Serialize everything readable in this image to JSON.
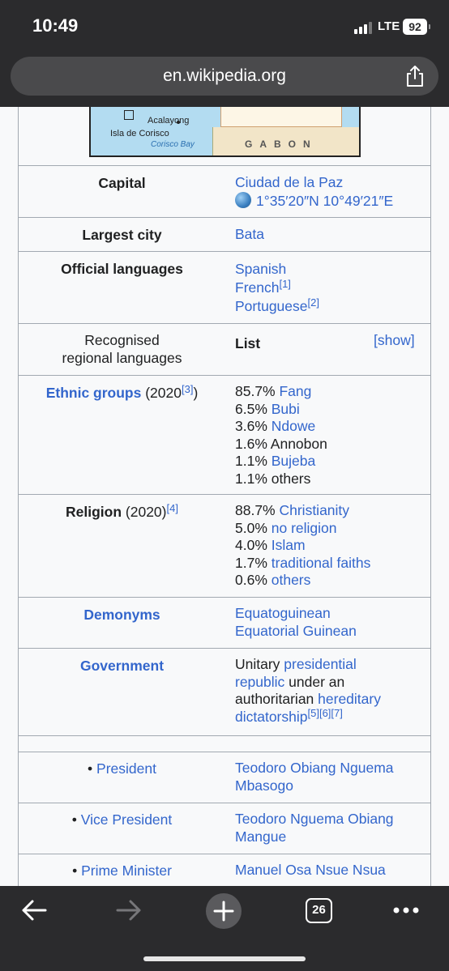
{
  "status_bar": {
    "time": "10:49",
    "network": "LTE",
    "battery": "92"
  },
  "browser": {
    "url": "en.wikipedia.org",
    "tab_count": "26"
  },
  "map": {
    "place1": "Acalayong",
    "place2": "Isla de Corisco",
    "bay": "Corisco Bay",
    "country": "GABON"
  },
  "infobox": {
    "capital": {
      "label": "Capital",
      "city": "Ciudad de la Paz",
      "coords": "1°35′20″N 10°49′21″E"
    },
    "largest_city": {
      "label": "Largest city",
      "value": "Bata"
    },
    "official_languages": {
      "label": "Official languages",
      "items": [
        "Spanish",
        "French",
        "Portuguese"
      ],
      "refs": [
        "[1]",
        "[2]"
      ]
    },
    "regional_languages": {
      "label_line1": "Recognised",
      "label_line2": "regional languages",
      "value": "List",
      "toggle": "[show]"
    },
    "ethnic_groups": {
      "label": "Ethnic groups",
      "year": " (2020",
      "ref": "[3]",
      "close": ")",
      "items": [
        {
          "pct": "85.7% ",
          "name": "Fang"
        },
        {
          "pct": "6.5% ",
          "name": "Bubi"
        },
        {
          "pct": "3.6% ",
          "name": "Ndowe"
        },
        {
          "pct": "1.6% ",
          "name": "Annobon"
        },
        {
          "pct": "1.1% ",
          "name": "Bujeba"
        },
        {
          "pct": "1.1% ",
          "name": "others"
        }
      ]
    },
    "religion": {
      "label": "Religion",
      "year": " (2020)",
      "ref": "[4]",
      "items": [
        {
          "pct": "88.7% ",
          "name": "Christianity"
        },
        {
          "pct": "5.0% ",
          "name": "no religion"
        },
        {
          "pct": "4.0% ",
          "name": "Islam"
        },
        {
          "pct": "1.7% ",
          "name": "traditional faiths"
        },
        {
          "pct": "0.6% ",
          "name": "others"
        }
      ]
    },
    "demonyms": {
      "label": "Demonyms",
      "items": [
        "Equatoguinean",
        "Equatorial Guinean"
      ]
    },
    "government": {
      "label": "Government",
      "t1": "Unitary ",
      "l1": "presidential",
      "l2": "republic",
      "t2": " under an",
      "t3": "authoritarian ",
      "l3": "hereditary",
      "l4": "dictatorship",
      "refs": "[5][6][7]"
    },
    "president": {
      "bullet": "• ",
      "label": "President",
      "line1": "Teodoro Obiang Nguema",
      "line2": "Mbasogo"
    },
    "vice_president": {
      "bullet": "• ",
      "label": "Vice President",
      "line1": "Teodoro Nguema Obiang",
      "line2": "Mangue"
    },
    "prime_minister": {
      "bullet": "• ",
      "label": "Prime Minister",
      "value": "Manuel Osa Nsue Nsua"
    }
  }
}
